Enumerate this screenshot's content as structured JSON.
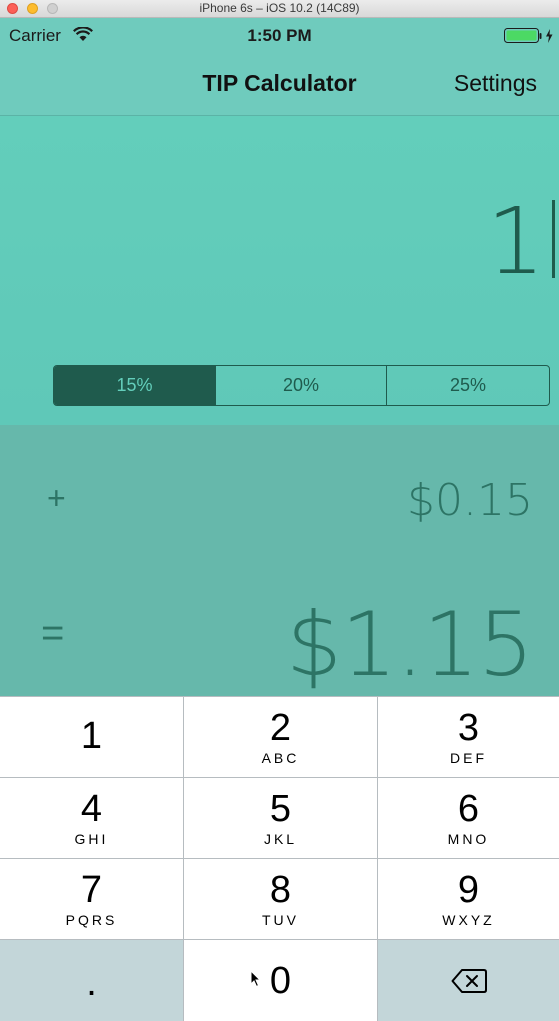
{
  "simulator": {
    "window_title": "iPhone 6s – iOS 10.2 (14C89)"
  },
  "status_bar": {
    "carrier": "Carrier",
    "time": "1:50 PM"
  },
  "nav": {
    "title": "TIP Calculator",
    "settings_label": "Settings"
  },
  "bill": {
    "amount": "1"
  },
  "tip_options": {
    "items": [
      "15%",
      "20%",
      "25%"
    ],
    "selected": "15%"
  },
  "results": {
    "plus": "+",
    "tip": "$0.15",
    "equals": "=",
    "total": "$1.15"
  },
  "keypad": {
    "keys": [
      {
        "digit": "1",
        "letters": ""
      },
      {
        "digit": "2",
        "letters": "ABC"
      },
      {
        "digit": "3",
        "letters": "DEF"
      },
      {
        "digit": "4",
        "letters": "GHI"
      },
      {
        "digit": "5",
        "letters": "JKL"
      },
      {
        "digit": "6",
        "letters": "MNO"
      },
      {
        "digit": "7",
        "letters": "PQRS"
      },
      {
        "digit": "8",
        "letters": "TUV"
      },
      {
        "digit": "9",
        "letters": "WXYZ"
      }
    ],
    "decimal": ".",
    "zero": "0"
  },
  "colors": {
    "nav_bar": "#6fcbbd",
    "bill_area": "#63cebb",
    "result_area": "#66b8ab",
    "accent_dark": "#1f5b4d"
  },
  "icons": [
    "wifi-icon",
    "battery-icon",
    "backspace-icon",
    "cursor-icon"
  ]
}
